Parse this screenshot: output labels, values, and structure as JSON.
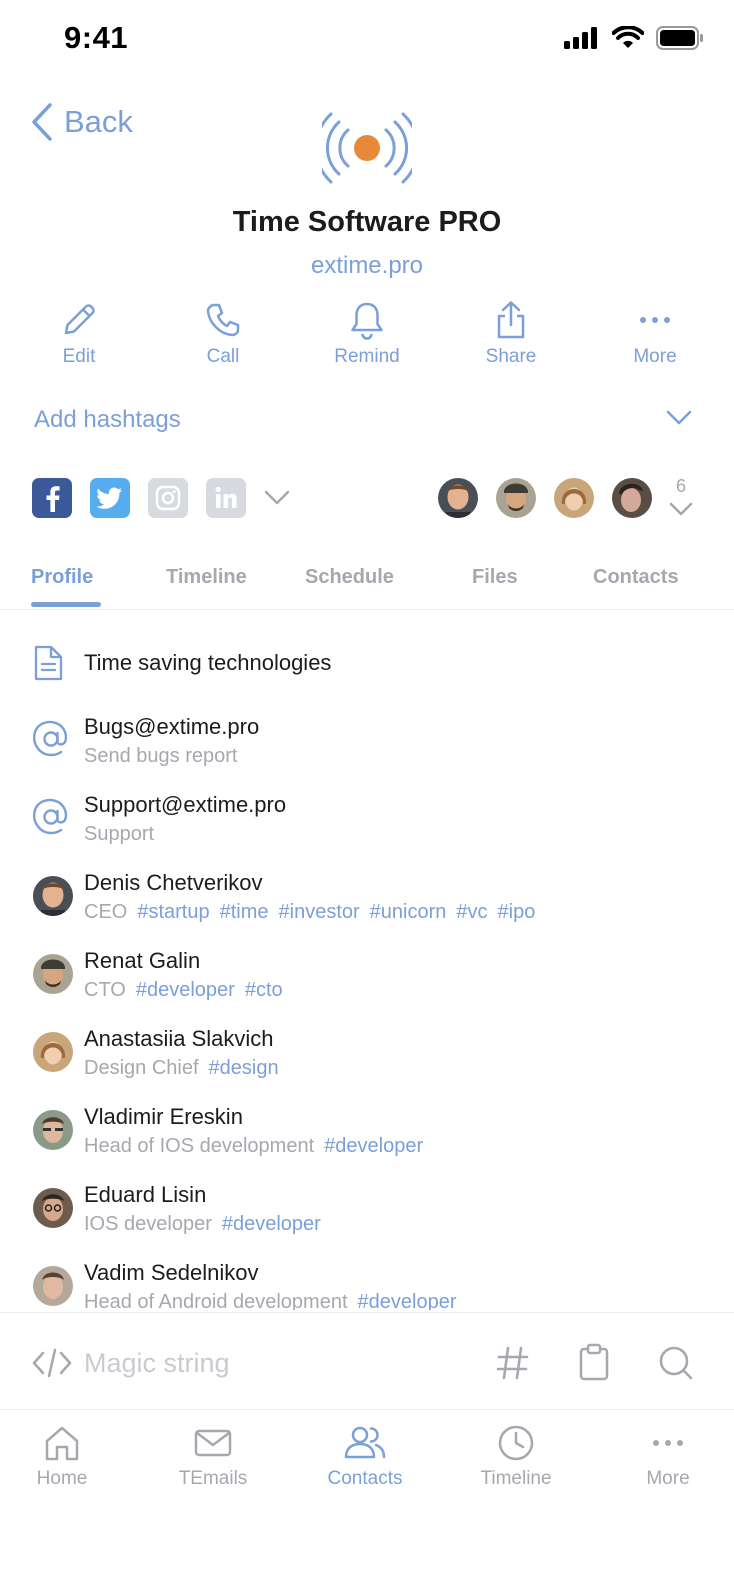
{
  "status_bar": {
    "time": "9:41"
  },
  "header": {
    "back_label": "Back",
    "company_name": "Time Software PRO",
    "website": "extime.pro"
  },
  "actions": [
    {
      "label": "Edit",
      "icon": "pencil-icon"
    },
    {
      "label": "Call",
      "icon": "phone-icon"
    },
    {
      "label": "Remind",
      "icon": "bell-icon"
    },
    {
      "label": "Share",
      "icon": "share-icon"
    },
    {
      "label": "More",
      "icon": "more-dots-icon"
    }
  ],
  "hashtags": {
    "label": "Add hashtags"
  },
  "social": {
    "networks": [
      "facebook",
      "twitter",
      "instagram",
      "linkedin"
    ],
    "members_count": "6"
  },
  "tabs": [
    "Profile",
    "Timeline",
    "Schedule",
    "Files",
    "Contacts"
  ],
  "profile": {
    "description": "Time saving technologies",
    "emails": [
      {
        "address": "Bugs@extime.pro",
        "note": "Send bugs report"
      },
      {
        "address": "Support@extime.pro",
        "note": "Support"
      }
    ],
    "people": [
      {
        "name": "Denis Chetverikov",
        "role": "CEO",
        "tags": [
          "#startup",
          "#time",
          "#investor",
          "#unicorn",
          "#vc",
          "#ipo"
        ]
      },
      {
        "name": "Renat Galin",
        "role": "CTO",
        "tags": [
          "#developer",
          "#cto"
        ]
      },
      {
        "name": "Anastasiia Slakvich",
        "role": "Design Chief",
        "tags": [
          "#design"
        ]
      },
      {
        "name": "Vladimir Ereskin",
        "role": "Head of IOS development",
        "tags": [
          "#developer"
        ]
      },
      {
        "name": "Eduard Lisin",
        "role": "IOS developer",
        "tags": [
          "#developer"
        ]
      },
      {
        "name": "Vadim Sedelnikov",
        "role": "Head of Android development",
        "tags": [
          "#developer"
        ]
      }
    ]
  },
  "magic_bar": {
    "placeholder": "Magic string"
  },
  "tabbar": [
    {
      "label": "Home",
      "icon": "home-icon"
    },
    {
      "label": "TEmails",
      "icon": "mail-icon"
    },
    {
      "label": "Contacts",
      "icon": "contacts-icon"
    },
    {
      "label": "Timeline",
      "icon": "clock-icon"
    },
    {
      "label": "More",
      "icon": "more-dots-icon"
    }
  ],
  "colors": {
    "accent": "#7b9fd9",
    "brand_orange": "#e8893a",
    "muted": "#a5a8ae"
  }
}
